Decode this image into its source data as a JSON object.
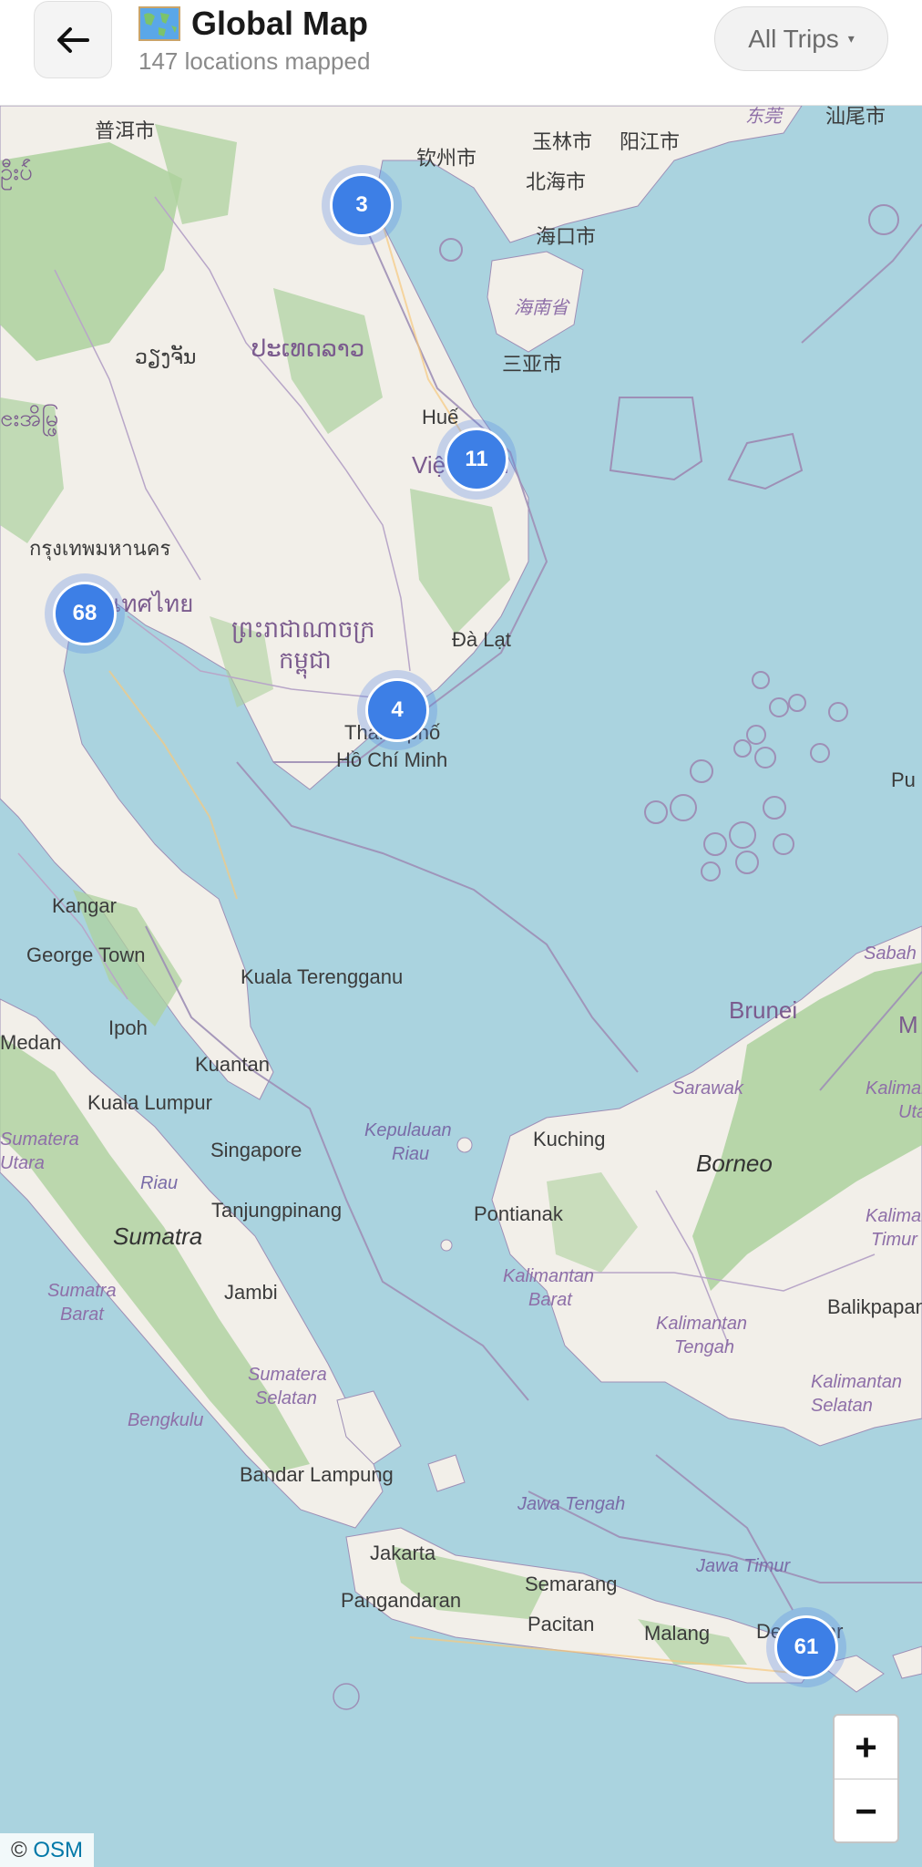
{
  "header": {
    "back_label": "←",
    "title": "Global Map",
    "subtitle": "147 locations mapped",
    "filter_label": "All Trips",
    "filter_caret": "▾"
  },
  "map": {
    "labels": {
      "puer": "普洱市",
      "qinzhou": "钦州市",
      "yulin": "玉林市",
      "yangjiang": "阳江市",
      "shanwei": "汕尾市",
      "dongguan": "东莞",
      "beihai": "北海市",
      "haikou": "海口市",
      "hainan": "海南省",
      "sanya": "三亚市",
      "vientiane": "ວຽງຈັນ",
      "laos": "ປະເທດລາວ",
      "myanmar_frag": "ၔးအိမ္ဖြ",
      "myanmar_top": "ဦးပ်ဴ",
      "hue": "Huế",
      "vietnam": "Việt Nam",
      "bangkok": "กรุงเทพมหานคร",
      "thailand": "ประเทศไทย",
      "cambodia1": "ព្រះរាជាណាចក្រ",
      "cambodia2": "កម្ពុជា",
      "dalat": "Đà Lạt",
      "hcm1": "Thành phố",
      "hcm2": "Hồ Chí Minh",
      "kangar": "Kangar",
      "georgetown": "George Town",
      "kualaterengganu": "Kuala Terengganu",
      "ipoh": "Ipoh",
      "medan": "Medan",
      "kuantan": "Kuantan",
      "kualalumpur": "Kuala Lumpur",
      "singapore": "Singapore",
      "tanjungpinang": "Tanjungpinang",
      "riau": "Riau",
      "kepriau1": "Kepulauan",
      "kepriau2": "Riau",
      "sumatra": "Sumatra",
      "sumutara1": "Sumatera",
      "sumutara2": "Utara",
      "sumbar1": "Sumatra",
      "sumbar2": "Barat",
      "jambi": "Jambi",
      "sumsel1": "Sumatera",
      "sumsel2": "Selatan",
      "bengkulu": "Bengkulu",
      "bandarlampung": "Bandar Lampung",
      "jakarta": "Jakarta",
      "pangandaran": "Pangandaran",
      "semarang": "Semarang",
      "pacitan": "Pacitan",
      "malang": "Malang",
      "denpasar": "Denpasar",
      "jawatengah": "Jawa Tengah",
      "jawatimur": "Jawa Timur",
      "kuching": "Kuching",
      "pontianak": "Pontianak",
      "kalbar1": "Kalimantan",
      "kalbar2": "Barat",
      "borneo": "Borneo",
      "sarawak": "Sarawak",
      "brunei": "Brunei",
      "sabah": "Sabah",
      "kalteng1": "Kalimantan",
      "kalteng2": "Tengah",
      "kaltim1": "Kalimantan",
      "kaltim2": "Timur",
      "kalsel1": "Kalimantan",
      "kalsel2": "Selatan",
      "kalut1": "Kalimantan",
      "kalut2": "Utara",
      "balikpapan": "Balikpapan",
      "m_frag": "M",
      "pu_frag": "Pu"
    },
    "clusters": [
      {
        "id": "hanoi",
        "count": "3"
      },
      {
        "id": "hue",
        "count": "11"
      },
      {
        "id": "bangkok",
        "count": "68"
      },
      {
        "id": "hcm",
        "count": "4"
      },
      {
        "id": "bali",
        "count": "61"
      }
    ],
    "zoom_in_label": "+",
    "zoom_out_label": "−",
    "attribution_prefix": "©",
    "attribution_link": "OSM"
  },
  "colors": {
    "water": "#aad3df",
    "land": "#f2efe9",
    "forest": "#add19e",
    "border": "#9e8fb6",
    "cluster": "#3d7fe6"
  }
}
